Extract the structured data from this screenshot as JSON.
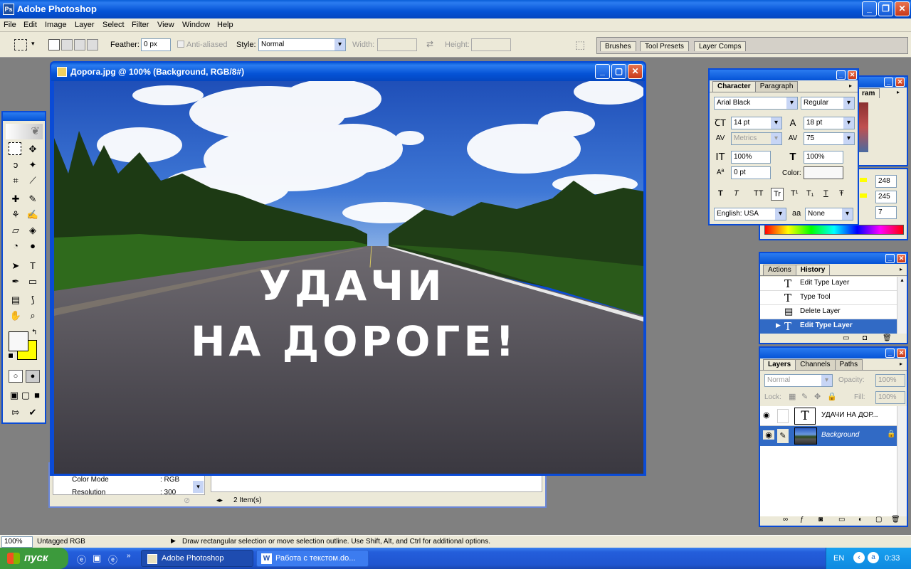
{
  "app": {
    "title": "Adobe Photoshop"
  },
  "menu": [
    "File",
    "Edit",
    "Image",
    "Layer",
    "Select",
    "Filter",
    "View",
    "Window",
    "Help"
  ],
  "options": {
    "feather_label": "Feather:",
    "feather_value": "0 px",
    "antialiased": "Anti-aliased",
    "style_label": "Style:",
    "style_value": "Normal",
    "width_label": "Width:",
    "height_label": "Height:"
  },
  "palette_well": [
    "Brushes",
    "Tool Presets",
    "Layer Comps"
  ],
  "doc": {
    "title": "Дорога.jpg @ 100% (Background, RGB/8#)",
    "line1": "УДАЧИ",
    "line2": "НА ДОРОГЕ!"
  },
  "behind": {
    "color_mode_label": "Color Mode",
    "color_mode_value": ": RGB",
    "resolution_label": "Resolution",
    "resolution_value": ": 300",
    "items": "2 Item(s)"
  },
  "character": {
    "tabs": [
      "Character",
      "Paragraph"
    ],
    "font": "Arial Black",
    "style": "Regular",
    "size": "14 pt",
    "leading": "18 pt",
    "kerning": "Metrics",
    "tracking": "75",
    "vscale": "100%",
    "hscale": "100%",
    "baseline": "0 pt",
    "color_label": "Color:",
    "language": "English: USA",
    "aa": "None",
    "aa_label": "aa",
    "styles": [
      "T",
      "T",
      "TT",
      "Tr",
      "T¹",
      "T₁",
      "T",
      "Ŧ"
    ]
  },
  "histogram": {
    "tab": "ram"
  },
  "color_values": [
    "248",
    "245",
    "7"
  ],
  "history": {
    "tabs": [
      "Actions",
      "History"
    ],
    "items": [
      "Edit Type Layer",
      "Type Tool",
      "Delete Layer",
      "Edit Type Layer"
    ]
  },
  "layers": {
    "tabs": [
      "Layers",
      "Channels",
      "Paths"
    ],
    "blend": "Normal",
    "opacity_label": "Opacity:",
    "opacity": "100%",
    "lock_label": "Lock:",
    "fill_label": "Fill:",
    "fill": "100%",
    "items": [
      {
        "name": "УДАЧИ  НА ДОР...",
        "thumb": "T"
      },
      {
        "name": "Background",
        "thumb": ""
      }
    ]
  },
  "status": {
    "zoom": "100%",
    "profile": "Untagged RGB",
    "hint": "Draw rectangular selection or move selection outline.  Use Shift, Alt, and Ctrl for additional options."
  },
  "taskbar": {
    "start": "пуск",
    "tasks": [
      "Adobe Photoshop",
      "Работа с текстом.do..."
    ],
    "lang": "EN",
    "clock": "0:33"
  },
  "colors": {
    "accent": "#0553d6",
    "fg": "#f8f8f8",
    "bg": "#ffff00",
    "start": "#3c9a3c"
  }
}
